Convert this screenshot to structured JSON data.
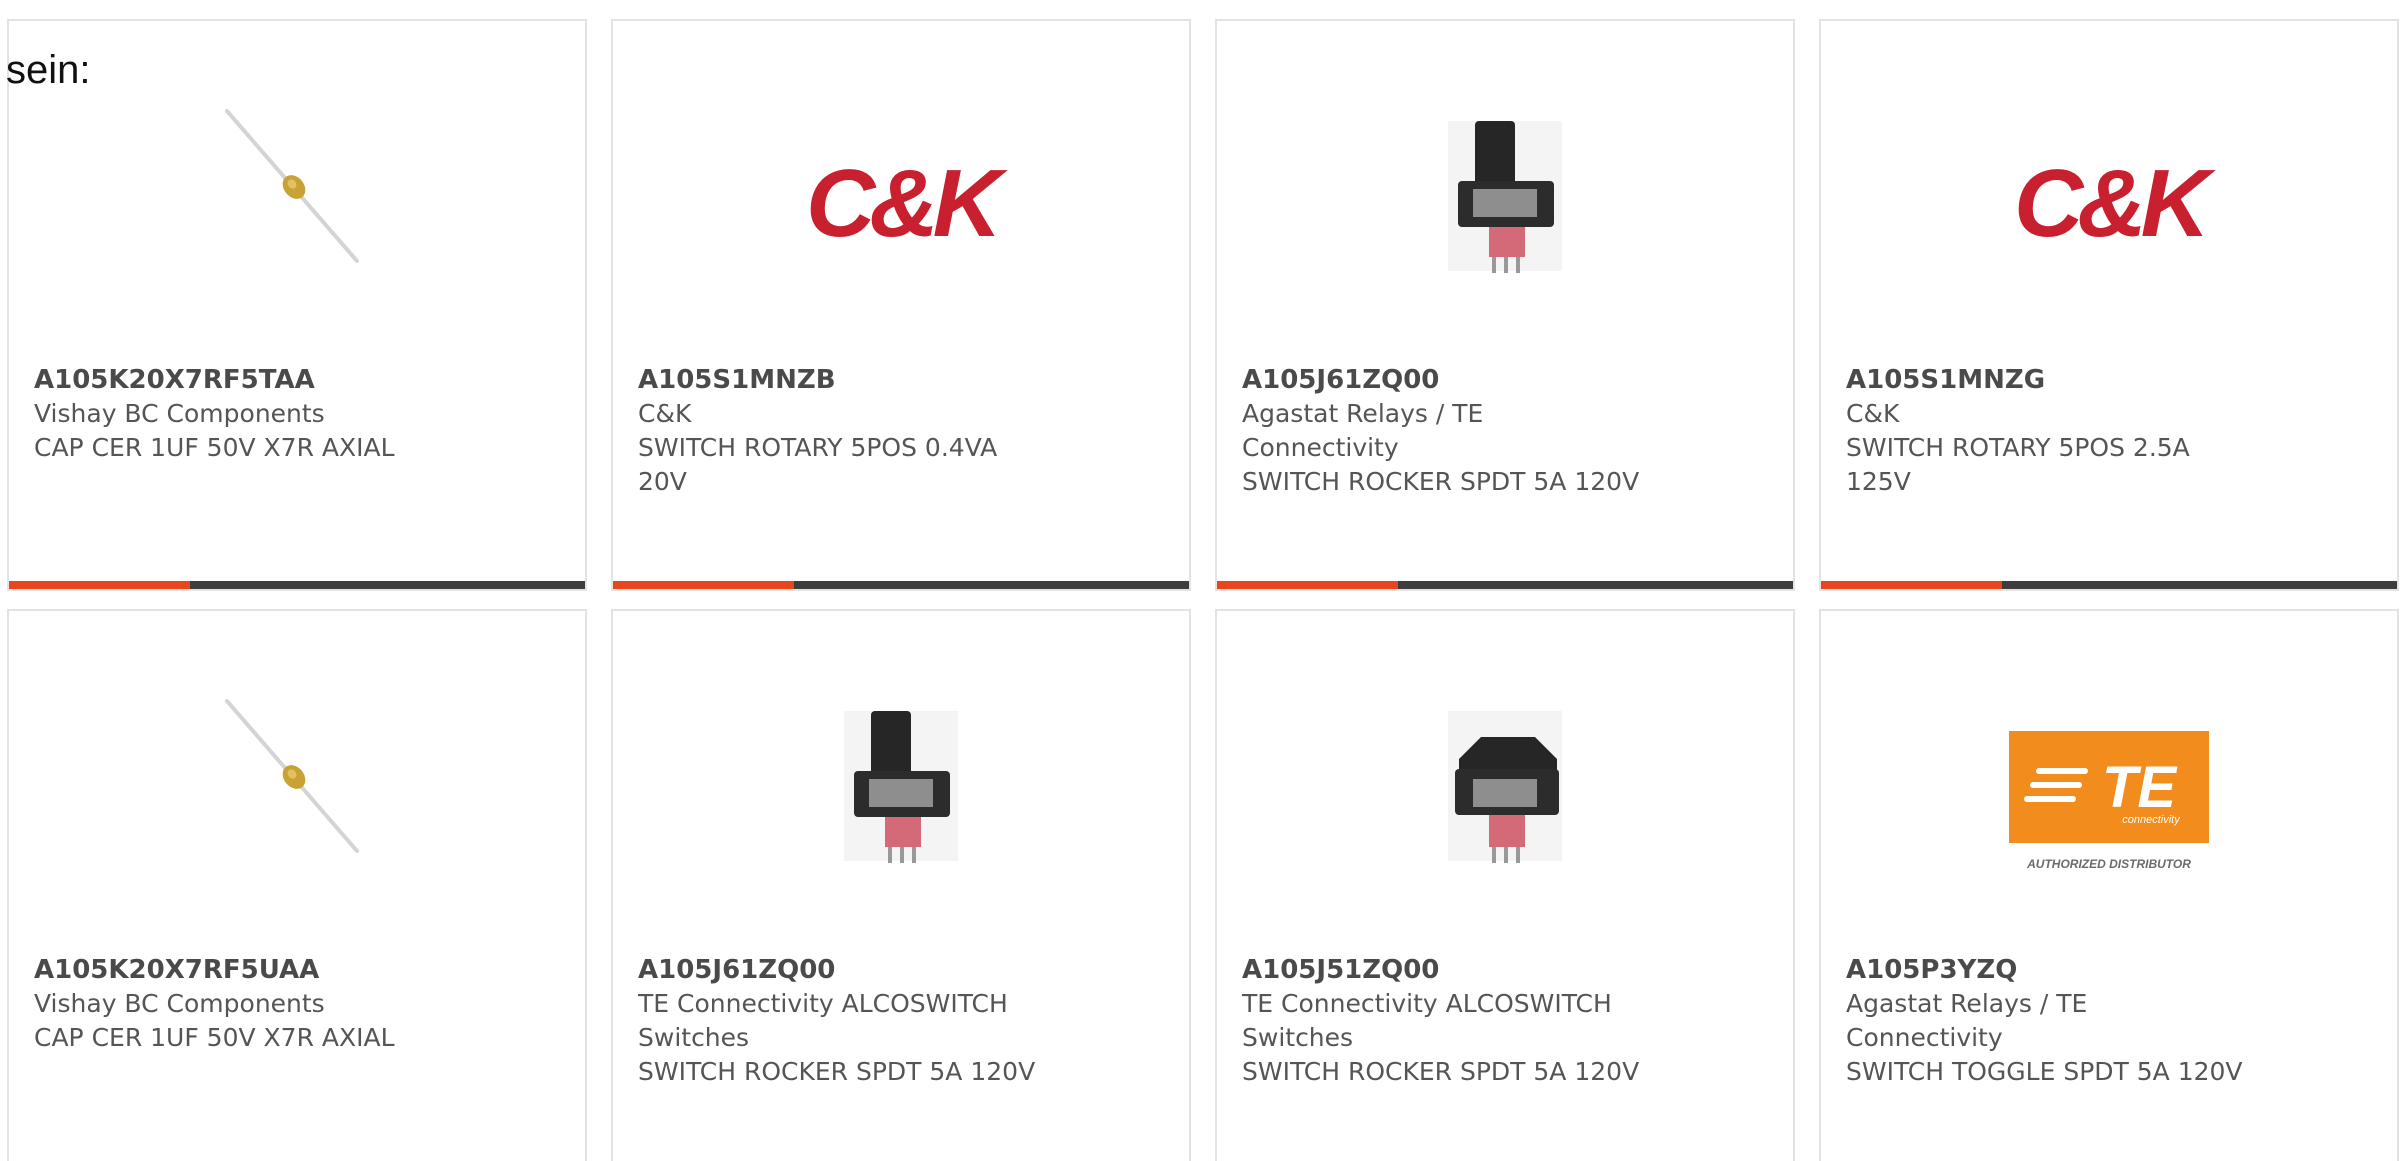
{
  "intro_text": "sein:",
  "products": [
    {
      "part": "A105K20X7RF5TAA",
      "manufacturer": "Vishay BC Components",
      "description": "CAP CER 1UF 50V X7R AXIAL",
      "image": "axial-capacitor"
    },
    {
      "part": "A105S1MNZB",
      "manufacturer": "C&K",
      "description": "SWITCH ROTARY 5POS 0.4VA 20V",
      "image": "ck-logo",
      "logo_text": "C&K"
    },
    {
      "part": "A105J61ZQ00",
      "manufacturer": "Agastat Relays / TE Connectivity",
      "description": "SWITCH ROCKER SPDT 5A 120V",
      "image": "rocker-switch"
    },
    {
      "part": "A105S1MNZG",
      "manufacturer": "C&K",
      "description": "SWITCH ROTARY 5POS 2.5A 125V",
      "image": "ck-logo",
      "logo_text": "C&K"
    },
    {
      "part": "A105K20X7RF5UAA",
      "manufacturer": "Vishay BC Components",
      "description": "CAP CER 1UF 50V X7R AXIAL",
      "image": "axial-capacitor"
    },
    {
      "part": "A105J61ZQ00",
      "manufacturer": "TE Connectivity ALCOSWITCH Switches",
      "description": "SWITCH ROCKER SPDT 5A 120V",
      "image": "rocker-switch"
    },
    {
      "part": "A105J51ZQ00",
      "manufacturer": "TE Connectivity ALCOSWITCH Switches",
      "description": "SWITCH ROCKER SPDT 5A 120V",
      "image": "rocker-switch-flat"
    },
    {
      "part": "A105P3YZQ",
      "manufacturer": "Agastat Relays / TE Connectivity",
      "description": "SWITCH TOGGLE SPDT 5A 120V",
      "image": "te-logo",
      "logo_text": "TE",
      "logo_subtext": "connectivity",
      "logo_caption": "AUTHORIZED DISTRIBUTOR"
    }
  ],
  "colors": {
    "accent": "#e8461c",
    "bar": "#3d3d3d",
    "ck_red": "#c8202f",
    "te_orange": "#f28c1c"
  }
}
